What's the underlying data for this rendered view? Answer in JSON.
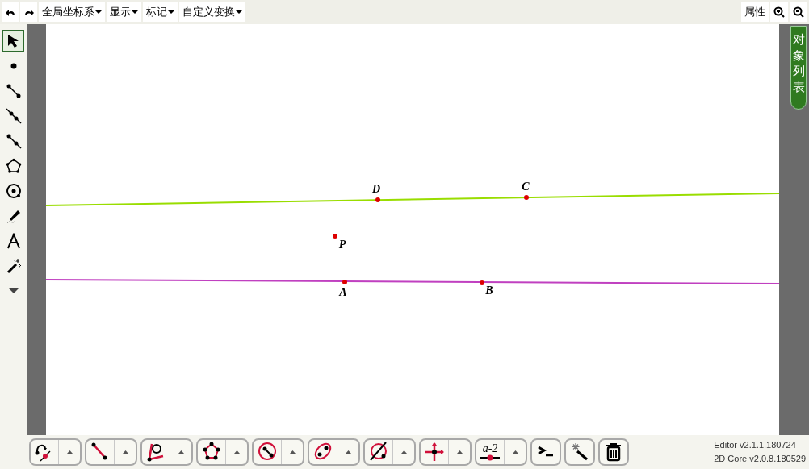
{
  "top_bar": {
    "menus": [
      {
        "label": "全局坐标系"
      },
      {
        "label": "显示"
      },
      {
        "label": "标记"
      },
      {
        "label": "自定义变换"
      }
    ],
    "properties_button": "属性"
  },
  "side_tab": {
    "label": "对象列表"
  },
  "left_tools": [
    {
      "kind": "arrow",
      "selected": true
    },
    {
      "kind": "point",
      "selected": false
    },
    {
      "kind": "segment",
      "selected": false
    },
    {
      "kind": "line",
      "selected": false
    },
    {
      "kind": "ray",
      "selected": false
    },
    {
      "kind": "polygon",
      "selected": false
    },
    {
      "kind": "circle",
      "selected": false
    },
    {
      "kind": "pen",
      "selected": false
    },
    {
      "kind": "text",
      "selected": false
    },
    {
      "kind": "wand",
      "selected": false
    },
    {
      "kind": "more",
      "selected": false
    }
  ],
  "canvas": {
    "lines": [
      {
        "color": "#99dd00"
      },
      {
        "color": "#c040c0"
      }
    ],
    "points": [
      {
        "label": "D"
      },
      {
        "label": "C"
      },
      {
        "label": "P"
      },
      {
        "label": "A"
      },
      {
        "label": "B"
      }
    ]
  },
  "bottom_tools": [
    {
      "kind": "transform",
      "menu": true
    },
    {
      "kind": "segment",
      "menu": true
    },
    {
      "kind": "angle",
      "menu": true
    },
    {
      "kind": "polygon",
      "menu": true
    },
    {
      "kind": "circle",
      "menu": true
    },
    {
      "kind": "ellipse",
      "menu": true
    },
    {
      "kind": "intersect",
      "menu": true
    },
    {
      "kind": "axes",
      "menu": true
    },
    {
      "kind": "parameter",
      "menu": true,
      "label": "a-2"
    },
    {
      "kind": "console",
      "menu": false
    },
    {
      "kind": "wand",
      "menu": false
    },
    {
      "kind": "trash",
      "menu": false
    }
  ],
  "version": [
    "Editor v2.1.1.180724",
    "2D Core v2.0.8.180529"
  ]
}
